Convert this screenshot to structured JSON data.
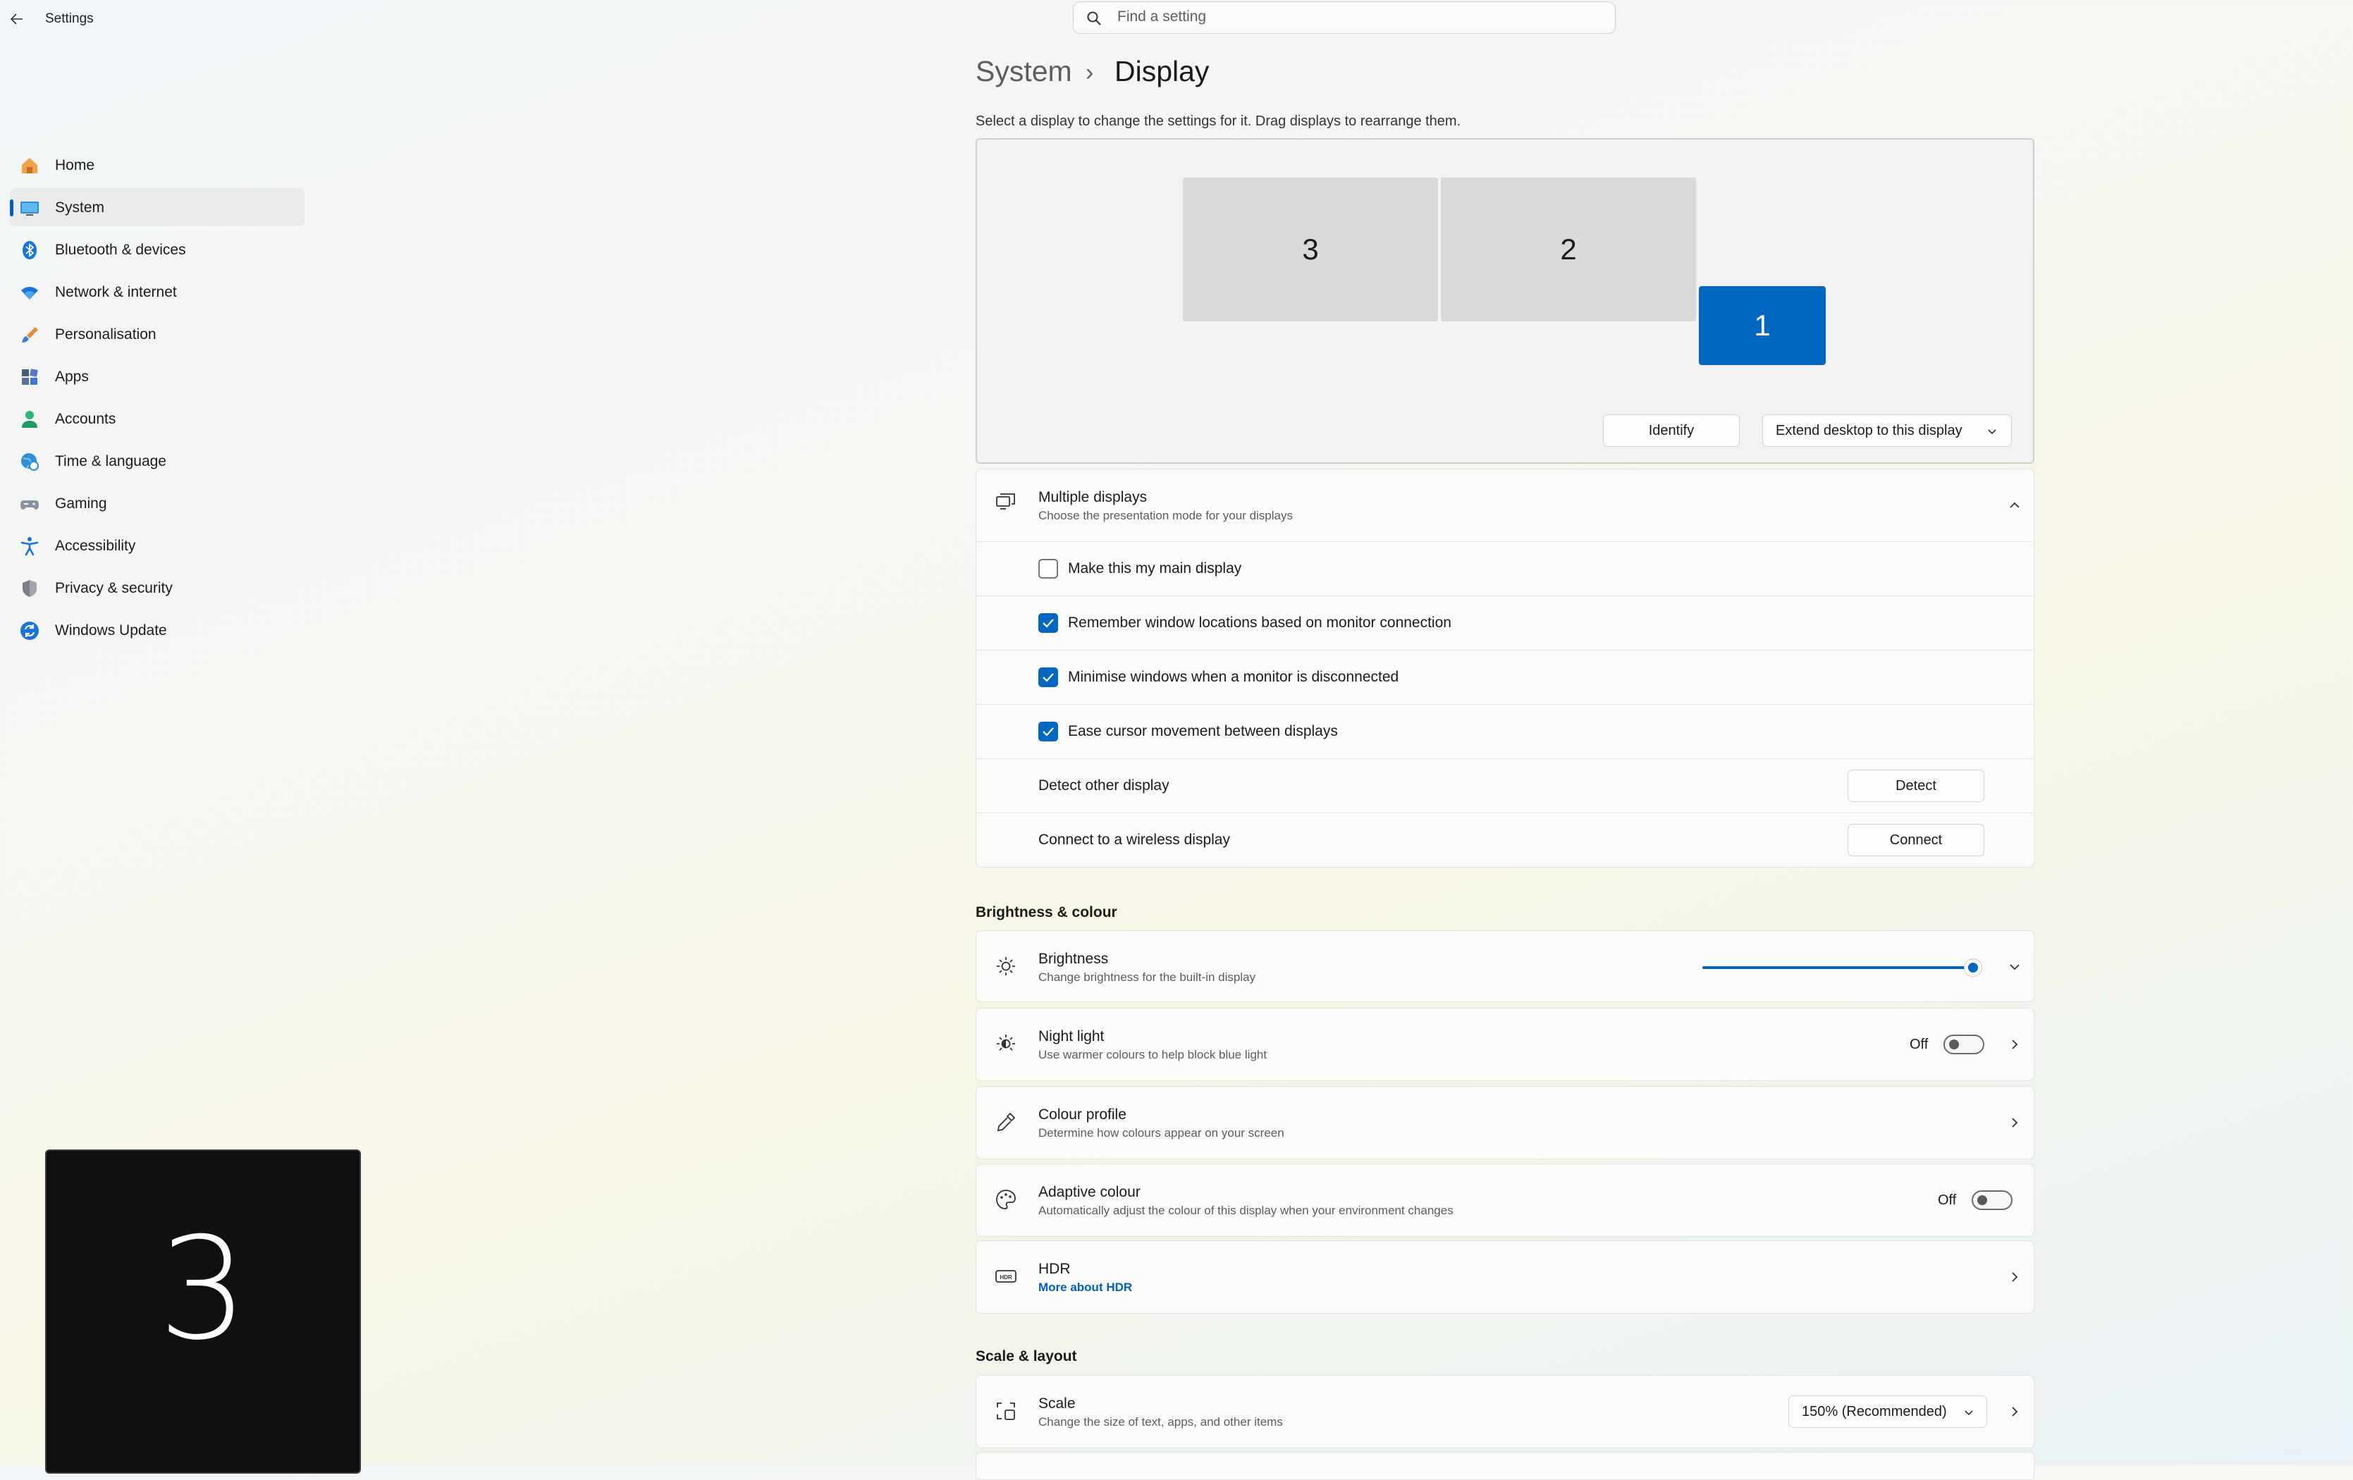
{
  "window": {
    "title": "Settings"
  },
  "search": {
    "placeholder": "Find a setting"
  },
  "sidebar": {
    "items": [
      {
        "label": "Home",
        "icon": "home-icon"
      },
      {
        "label": "System",
        "icon": "system-icon",
        "active": true
      },
      {
        "label": "Bluetooth & devices",
        "icon": "bluetooth-icon"
      },
      {
        "label": "Network & internet",
        "icon": "wifi-icon"
      },
      {
        "label": "Personalisation",
        "icon": "brush-icon"
      },
      {
        "label": "Apps",
        "icon": "apps-icon"
      },
      {
        "label": "Accounts",
        "icon": "account-icon"
      },
      {
        "label": "Time & language",
        "icon": "globe-clock-icon"
      },
      {
        "label": "Gaming",
        "icon": "gamepad-icon"
      },
      {
        "label": "Accessibility",
        "icon": "accessibility-icon"
      },
      {
        "label": "Privacy & security",
        "icon": "shield-icon"
      },
      {
        "label": "Windows Update",
        "icon": "update-icon"
      }
    ]
  },
  "breadcrumb": {
    "parent": "System",
    "separator": "›",
    "current": "Display"
  },
  "arrange": {
    "instructions": "Select a display to change the settings for it. Drag displays to rearrange them.",
    "monitors": [
      {
        "label": "3"
      },
      {
        "label": "2"
      },
      {
        "label": "1",
        "selected": true
      }
    ],
    "identify_label": "Identify",
    "extend_label": "Extend desktop to this display"
  },
  "multiple_displays": {
    "title": "Multiple displays",
    "subtitle": "Choose the presentation mode for your displays",
    "options": [
      {
        "label": "Make this my main display",
        "checked": false
      },
      {
        "label": "Remember window locations based on monitor connection",
        "checked": true
      },
      {
        "label": "Minimise windows when a monitor is disconnected",
        "checked": true
      },
      {
        "label": "Ease cursor movement between displays",
        "checked": true
      }
    ],
    "detect": {
      "label": "Detect other display",
      "button": "Detect"
    },
    "wireless": {
      "label": "Connect to a wireless display",
      "button": "Connect"
    }
  },
  "brightness_colour": {
    "heading": "Brightness & colour",
    "brightness": {
      "title": "Brightness",
      "subtitle": "Change brightness for the built-in display",
      "value_percent": 100
    },
    "night_light": {
      "title": "Night light",
      "subtitle": "Use warmer colours to help block blue light",
      "state": "Off"
    },
    "colour_profile": {
      "title": "Colour profile",
      "subtitle": "Determine how colours appear on your screen"
    },
    "adaptive_colour": {
      "title": "Adaptive colour",
      "subtitle": "Automatically adjust the colour of this display when your environment changes",
      "state": "Off"
    },
    "hdr": {
      "title": "HDR",
      "link": "More about HDR"
    }
  },
  "scale_layout": {
    "heading": "Scale & layout",
    "scale": {
      "title": "Scale",
      "subtitle": "Change the size of text, apps, and other items",
      "value": "150% (Recommended)"
    }
  },
  "identify_overlay": {
    "number": "3"
  },
  "colors": {
    "accent": "#0067c0",
    "link": "#005fb8"
  }
}
